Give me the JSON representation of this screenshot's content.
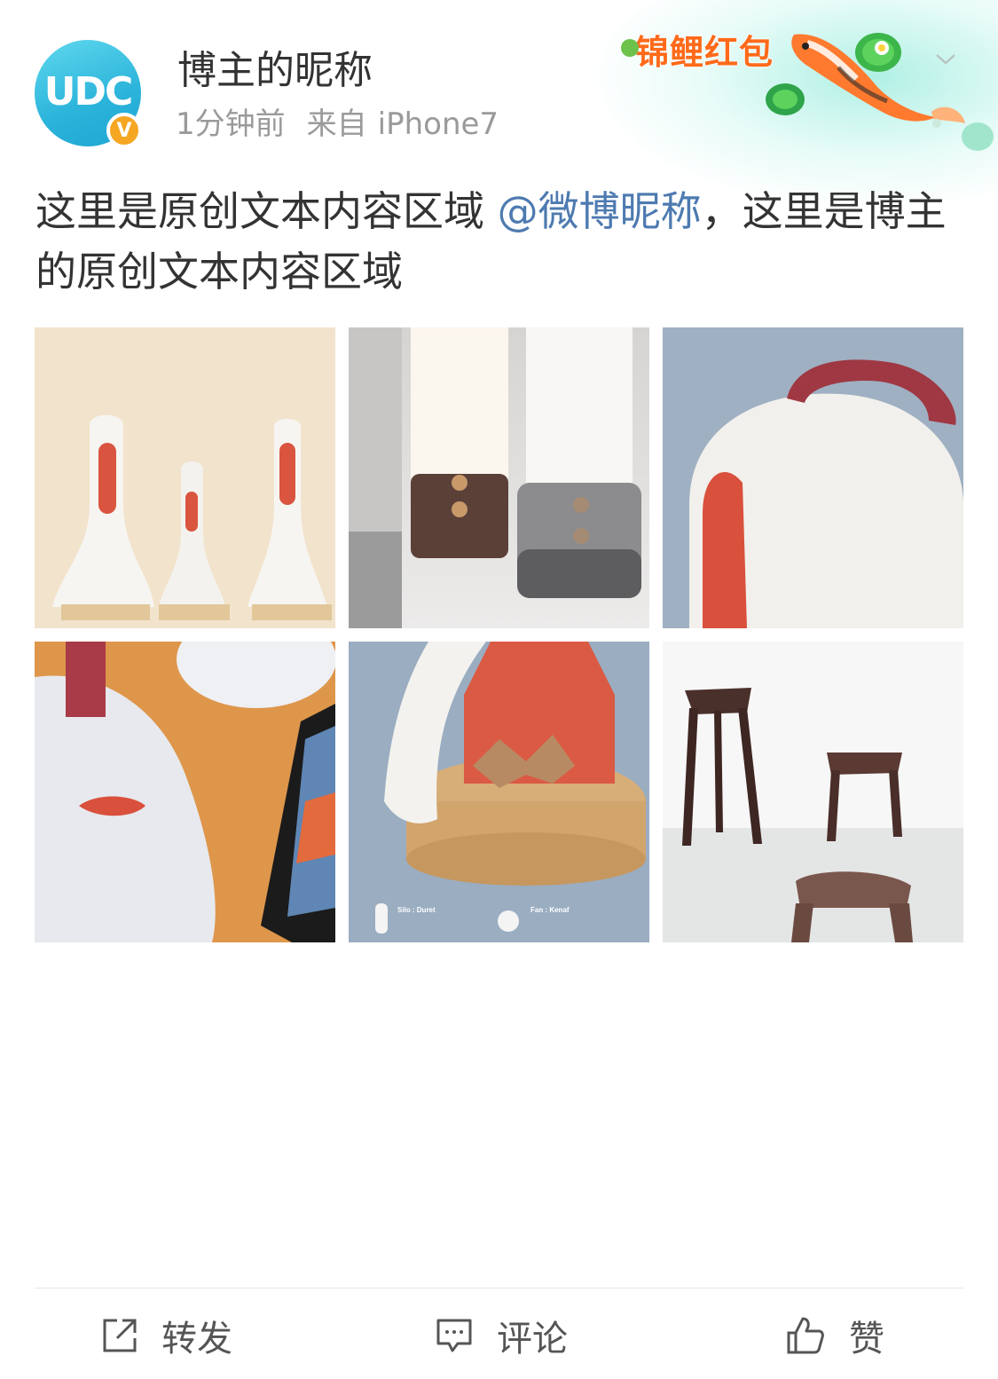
{
  "post": {
    "author": {
      "nickname": "博主的昵称",
      "avatar_text": "UDC",
      "verified_mark": "V"
    },
    "time": "1分钟前",
    "source_label": "来自",
    "device": "iPhone7",
    "promo_label": "锦鲤红包",
    "text_before": "这里是原创文本内容区域 ",
    "mention": "@微博昵称",
    "text_after": "，这里是博主的原创文本内容区域",
    "images": [
      {
        "name": "image-bells-on-beige",
        "alt": "三个白色钟形产品"
      },
      {
        "name": "image-speaker-lamps",
        "alt": "白色灯柱与扬声器"
      },
      {
        "name": "image-dome-with-strap",
        "alt": "带红色提带的白色圆顶"
      },
      {
        "name": "image-dome-on-wood",
        "alt": "木桌上的产品与手机"
      },
      {
        "name": "image-cork-base-cutaway",
        "alt": "软木底座剖面"
      },
      {
        "name": "image-stools",
        "alt": "布艺凳子"
      }
    ],
    "poster_captions": {
      "left": "Silo : Duret",
      "right": "Fan : Kenaf"
    }
  },
  "actions": {
    "repost_label": "转发",
    "comment_label": "评论",
    "like_label": "赞"
  },
  "colors": {
    "mention": "#4d7ab0",
    "avatar": "#2bb3da",
    "verified": "#f5a623",
    "promo": "#ff6a1a"
  },
  "icons": [
    "share-icon",
    "comment-icon",
    "like-icon",
    "chevron-down-icon",
    "koi-icon"
  ]
}
